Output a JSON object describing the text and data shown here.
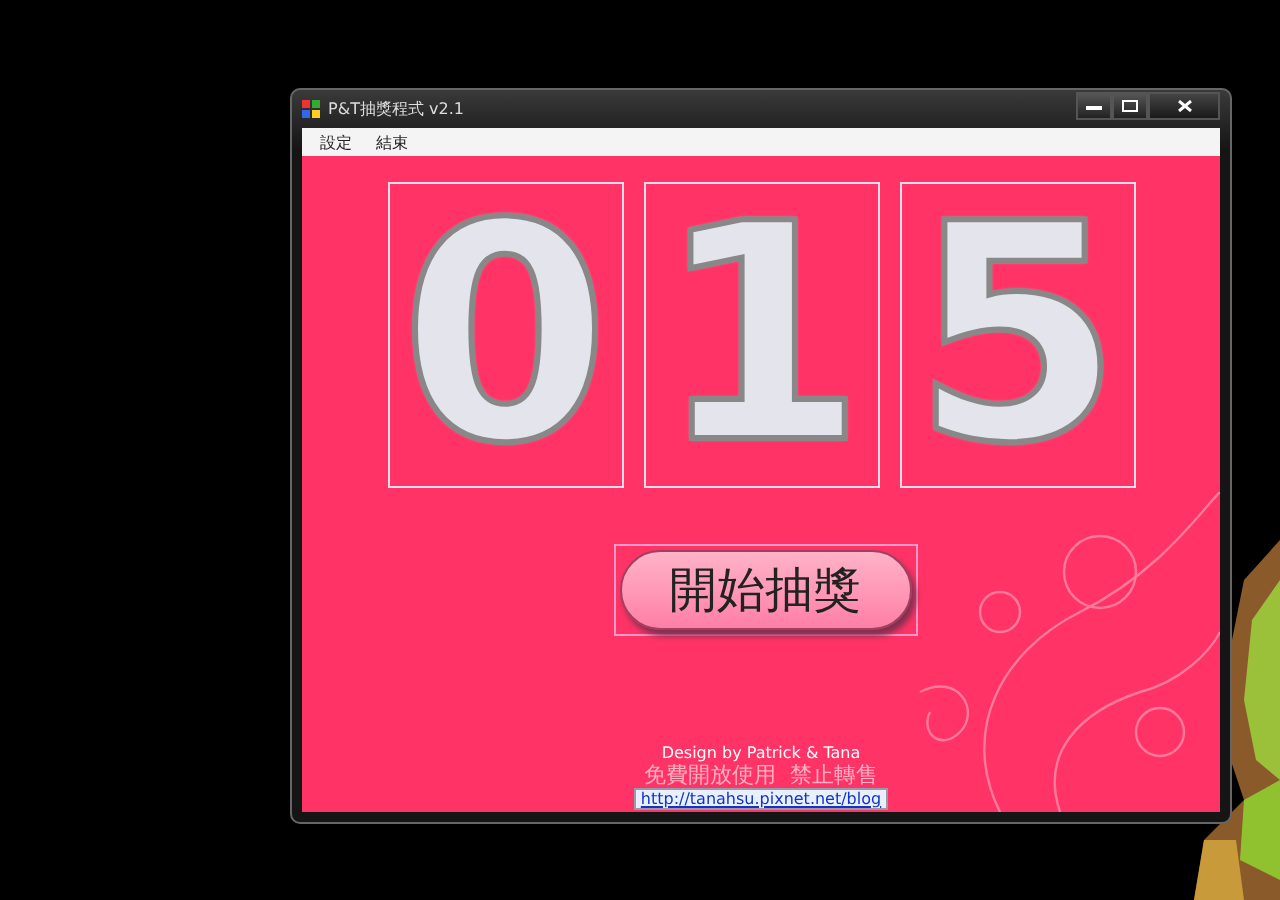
{
  "window": {
    "title": "P&T抽獎程式 v2.1"
  },
  "menu": [
    {
      "label": "設定"
    },
    {
      "label": "結束"
    }
  ],
  "digits": [
    "0",
    "1",
    "5"
  ],
  "start_button": {
    "label": "開始抽獎"
  },
  "credits": {
    "design": "Design by Patrick & Tana",
    "notice": "免費開放使用  禁止轉售",
    "link": "http://tanahsu.pixnet.net/blog"
  }
}
